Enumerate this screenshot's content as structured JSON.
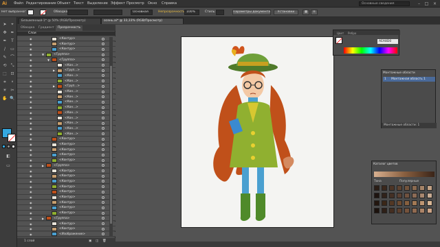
{
  "menubar": {
    "logo": "Ai",
    "items": [
      "Файл",
      "Редактирование",
      "Объект",
      "Текст",
      "Выделение",
      "Эффект",
      "Просмотр",
      "Окно",
      "Справка"
    ],
    "workspace": "Основные сведения",
    "window_controls": [
      "–",
      "□",
      "×"
    ]
  },
  "controlbar": {
    "no_selection_label": "Нет выбранного объекта",
    "stroke_label": "Обводка:",
    "style_field": "Основная",
    "opacity_label": "Непрозрачность:",
    "opacity_value": "100%",
    "style_label": "Стиль:",
    "doc_setup_button": "Параметры документа",
    "preferences_button": "Установки",
    "fill_color": "#f0f0f0",
    "stroke_color": "#ff3333"
  },
  "doctabs": [
    {
      "label": "Безымянный-1* @ 50% (RGB/Просмотр)",
      "active": false
    },
    {
      "label": "осень.ai* @ 33,33% (RGB/Просмотр)",
      "active": true
    }
  ],
  "tools": [
    "➤",
    "⌖",
    "✥",
    "✒",
    "T",
    "/",
    "▭",
    "✎",
    "⌒",
    "⟲",
    "⤡",
    "⬚",
    "⊡",
    "⌗",
    "⚬",
    "☀",
    "✂",
    "✋",
    "🔍"
  ],
  "layers_panel": {
    "tabs": [
      {
        "label": "Обводка",
        "active": false
      },
      {
        "label": "Градиент",
        "active": false
      },
      {
        "label": "Прозрачность",
        "active": true
      }
    ],
    "header": "Слои",
    "rows": [
      {
        "name": "<Контур>",
        "indent": 2
      },
      {
        "name": "<Контур>",
        "indent": 2
      },
      {
        "name": "<Контур>",
        "indent": 2
      },
      {
        "name": "<Группа>",
        "indent": 1,
        "expanded": true
      },
      {
        "name": "<Группа>",
        "indent": 2,
        "expanded": true
      },
      {
        "name": "<Кон...>",
        "indent": 3
      },
      {
        "name": "<Груп...>",
        "indent": 3
      },
      {
        "name": "<Кон...>",
        "indent": 3
      },
      {
        "name": "<Кон...>",
        "indent": 3
      },
      {
        "name": "<Груп...>",
        "indent": 3
      },
      {
        "name": "<Кон...>",
        "indent": 3
      },
      {
        "name": "<Кон...>",
        "indent": 3
      },
      {
        "name": "<Кон...>",
        "indent": 3
      },
      {
        "name": "<Кон...>",
        "indent": 3
      },
      {
        "name": "<Кон...>",
        "indent": 3
      },
      {
        "name": "<Кон...>",
        "indent": 3
      },
      {
        "name": "<Кон...>",
        "indent": 3
      },
      {
        "name": "<Кон...>",
        "indent": 3
      },
      {
        "name": "<Кон...>",
        "indent": 3
      },
      {
        "name": "<Контур>",
        "indent": 2
      },
      {
        "name": "<Контур>",
        "indent": 2
      },
      {
        "name": "<Контур>",
        "indent": 2
      },
      {
        "name": "<Контур>",
        "indent": 2
      },
      {
        "name": "<Контур>",
        "indent": 2
      },
      {
        "name": "<Группа>",
        "indent": 1
      },
      {
        "name": "<Контур>",
        "indent": 2
      },
      {
        "name": "<Контур>",
        "indent": 2
      },
      {
        "name": "<Контур>",
        "indent": 2
      },
      {
        "name": "<Контур>",
        "indent": 2
      },
      {
        "name": "<Контур>",
        "indent": 2
      },
      {
        "name": "<Контур>",
        "indent": 2
      },
      {
        "name": "<Контур>",
        "indent": 2
      },
      {
        "name": "<Контур>",
        "indent": 2
      },
      {
        "name": "<Контур>",
        "indent": 2
      },
      {
        "name": "<Группа>",
        "indent": 1
      },
      {
        "name": "<Контур>",
        "indent": 2
      },
      {
        "name": "<Контур>",
        "indent": 2
      },
      {
        "name": "<Изображение>",
        "indent": 2
      }
    ],
    "footer": "1 слой"
  },
  "color_panel": {
    "tabs": [
      "Цвет",
      "Ребро"
    ],
    "hex": "AEA8D0"
  },
  "artboards_panel": {
    "title": "Монтажные области",
    "row_index": "1",
    "row_label": "Монтажная область 1",
    "footer": "Монтажные области: 1"
  },
  "swatch_panel": {
    "title": "Каталог цветов",
    "label_left": "Тона",
    "label_right": "Популярные",
    "colors": [
      "#2b1d15",
      "#3b281c",
      "#4d3526",
      "#5e4331",
      "#73543d",
      "#8a6a50",
      "#a58468",
      "#c2a285",
      "#1e1410",
      "#30221a",
      "#443025",
      "#5a4032",
      "#70523f",
      "#8c6b55",
      "#a8876f",
      "#c8ab93",
      "#23160f",
      "#3a2718",
      "#533824",
      "#6d4b31",
      "#87603f",
      "#a47a55",
      "#bf9672",
      "#d9b795",
      "#1c120d",
      "#2e1f17",
      "#442e21",
      "#5c3f2d",
      "#76533c",
      "#916a50",
      "#ac8468",
      "#cba386"
    ]
  }
}
